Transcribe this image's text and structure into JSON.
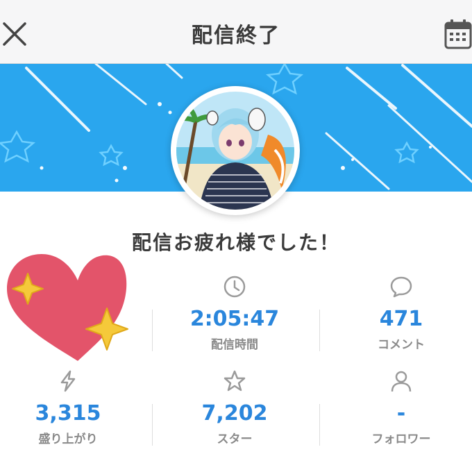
{
  "header": {
    "title": "配信終了",
    "close_icon": "close-icon",
    "calendar_icon": "calendar-icon"
  },
  "profile": {
    "greeting": "配信お疲れ様でした！"
  },
  "stats": [
    {
      "value": "2:05:47",
      "label": "配信時間",
      "icon": "clock-icon"
    },
    {
      "value": "471",
      "label": "コメント",
      "icon": "comment-icon"
    },
    {
      "value": "3,315",
      "label": "盛り上がり",
      "icon": "lightning-icon"
    },
    {
      "value": "7,202",
      "label": "スター",
      "icon": "star-icon"
    },
    {
      "value": "-",
      "label": "フォロワー",
      "icon": "person-icon"
    }
  ],
  "colors": {
    "accent": "#2a86dc",
    "banner": "#2aa6ee",
    "heart": "#e3546a",
    "sparkle": "#f5c93a"
  }
}
